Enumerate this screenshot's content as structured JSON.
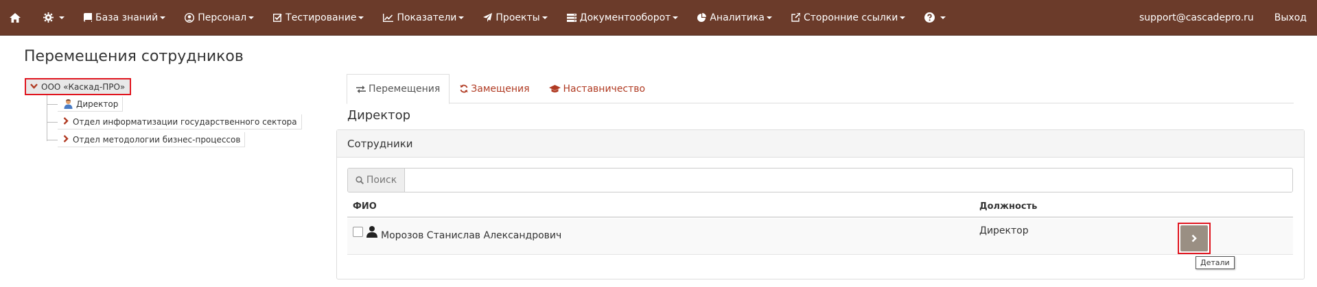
{
  "colors": {
    "navbar_bg": "#6b3b2a",
    "accent": "#b03a22",
    "highlight_border": "#e0141e",
    "details_button": "#9a8f83"
  },
  "navbar": {
    "home_icon": "home-icon",
    "settings_icon": "gear-icon",
    "items": [
      {
        "label": "База знаний",
        "icon": "book-icon"
      },
      {
        "label": "Персонал",
        "icon": "user-circle-icon"
      },
      {
        "label": "Тестирование",
        "icon": "checkbox-icon"
      },
      {
        "label": "Показатели",
        "icon": "line-chart-icon"
      },
      {
        "label": "Проекты",
        "icon": "paper-plane-icon"
      },
      {
        "label": "Документооборот",
        "icon": "server-icon"
      },
      {
        "label": "Аналитика",
        "icon": "pie-chart-icon"
      },
      {
        "label": "Сторонние ссылки",
        "icon": "external-link-icon"
      }
    ],
    "help_icon": "question-circle-icon",
    "user_email": "support@cascadepro.ru",
    "logout_label": "Выход"
  },
  "page": {
    "title": "Перемещения сотрудников"
  },
  "tree": {
    "root_label": "ООО «Каскад-ПРО»",
    "nodes": [
      {
        "label": "Директор",
        "icon": "person-icon"
      },
      {
        "label": "Отдел информатизации государственного сектора",
        "icon": "chevron-right-icon"
      },
      {
        "label": "Отдел методологии бизнес-процессов",
        "icon": "chevron-right-icon"
      }
    ]
  },
  "tabs": [
    {
      "label": "Перемещения",
      "icon": "exchange-icon",
      "active": true
    },
    {
      "label": "Замещения",
      "icon": "refresh-icon",
      "active": false
    },
    {
      "label": "Наставничество",
      "icon": "graduation-cap-icon",
      "active": false
    }
  ],
  "section": {
    "title": "Директор"
  },
  "panel": {
    "heading": "Сотрудники",
    "search_label": "Поиск",
    "search_value": "",
    "columns": {
      "fio": "ФИО",
      "position": "Должность"
    },
    "rows": [
      {
        "name": "Морозов Станислав Александрович",
        "position": "Директор"
      }
    ],
    "details_tooltip": "Детали"
  }
}
